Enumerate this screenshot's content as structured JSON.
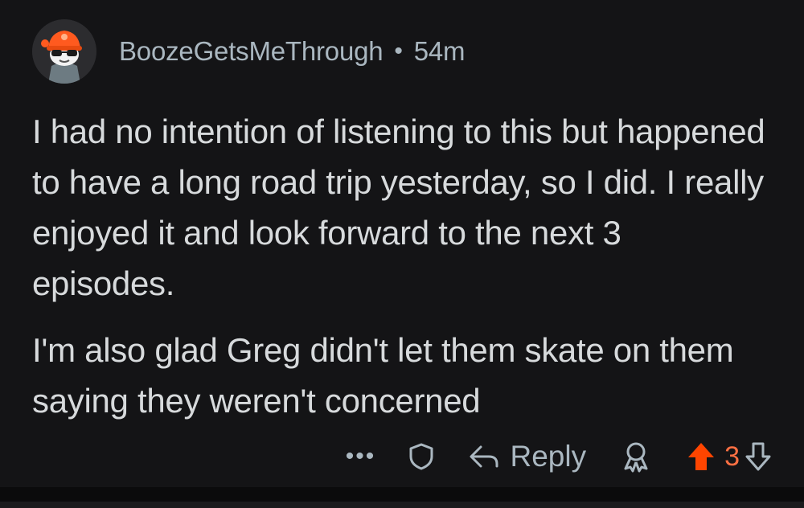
{
  "comment": {
    "author": "BoozeGetsMeThrough",
    "separator": "•",
    "time": "54m",
    "paragraphs": [
      "I had no intention of listening to this but happened to have a long road trip yesterday, so I did. I really enjoyed it and look forward to the next 3 episodes.",
      "I'm also glad Greg didn't let them skate on them saying they weren't concerned"
    ]
  },
  "actions": {
    "more_label": "•••",
    "reply_label": "Reply",
    "score": "3"
  },
  "colors": {
    "background": "#141416",
    "text": "#d7dadc",
    "meta": "#aab7c0",
    "upvote": "#ff4500",
    "score": "#ff7043"
  },
  "icons": [
    "avatar-image",
    "shield-icon",
    "reply-arrow-icon",
    "award-icon",
    "upvote-icon",
    "downvote-icon"
  ]
}
